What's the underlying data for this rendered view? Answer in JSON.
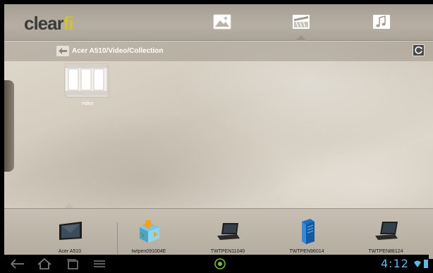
{
  "app": {
    "logo_main": "clear",
    "logo_accent": "fi"
  },
  "media_tabs": [
    {
      "name": "photos",
      "icon": "image-icon",
      "active": false
    },
    {
      "name": "videos",
      "icon": "video-clapper-icon",
      "active": true
    },
    {
      "name": "music",
      "icon": "music-icon",
      "active": false
    }
  ],
  "path": {
    "text": "Acer A510/Video/Collection"
  },
  "items": [
    {
      "label": "video",
      "icon": "video-folder-icon"
    }
  ],
  "devices": [
    {
      "label": "Acer A510",
      "icon": "tablet-icon",
      "selected": true
    },
    {
      "label": "twtpen091004E",
      "icon": "media-server-icon"
    },
    {
      "label": "TWTPEN11040",
      "icon": "laptop-icon"
    },
    {
      "label": "TWTPEN96014",
      "icon": "server-icon"
    },
    {
      "label": "TWTPEN88124",
      "icon": "laptop-icon"
    }
  ],
  "status": {
    "time": "4:12"
  },
  "colors": {
    "accent_yellow": "#d4c234",
    "clock_blue": "#5bb9e6"
  }
}
